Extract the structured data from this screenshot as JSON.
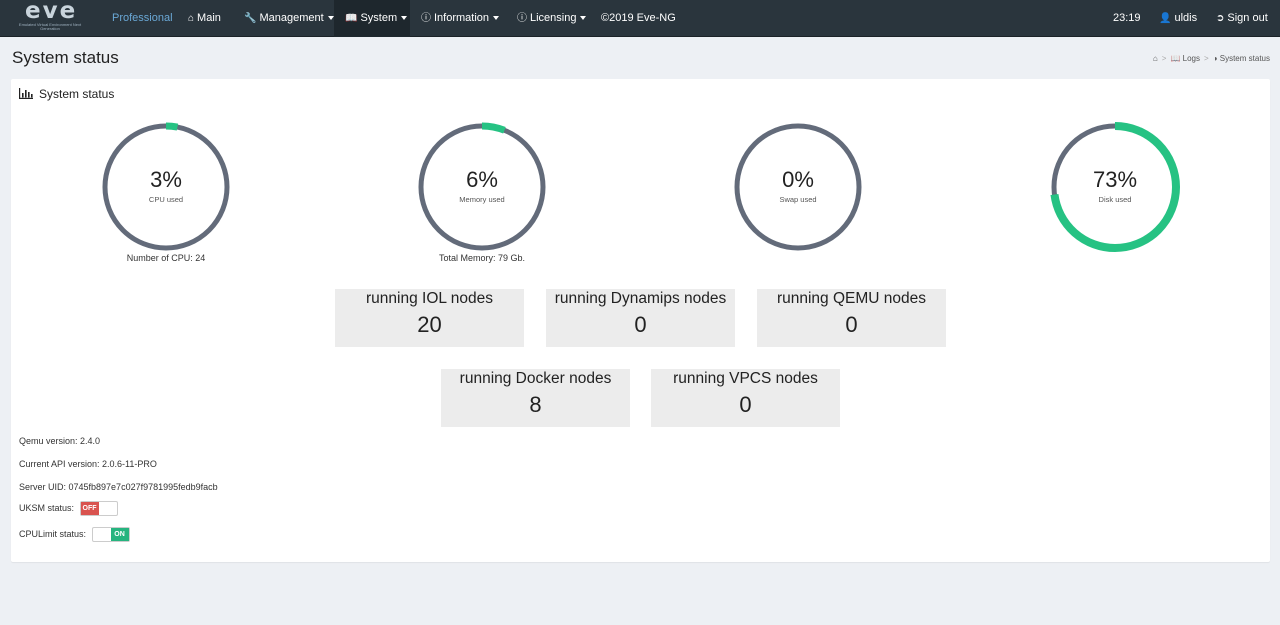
{
  "nav": {
    "logo_text": "eve",
    "logo_subtitle": "Emulated Virtual Environment Next Generation",
    "edition": "Professional",
    "items": [
      {
        "icon": "home-icon",
        "label": "Main",
        "caret": false
      },
      {
        "icon": "wrench-icon",
        "label": "Management",
        "caret": true
      },
      {
        "icon": "book-icon",
        "label": "System",
        "caret": true
      },
      {
        "icon": "info-icon",
        "label": "Information",
        "caret": true
      },
      {
        "icon": "info-icon",
        "label": "Licensing",
        "caret": true
      }
    ],
    "copyright": "©2019 Eve-NG",
    "time": "23:19",
    "user": "uldis",
    "signout": "Sign out"
  },
  "page": {
    "title": "System status",
    "breadcrumb": [
      "Logs",
      "System status"
    ]
  },
  "panel": {
    "title": "System status",
    "gauges": [
      {
        "value": "3%",
        "percent": 3,
        "label": "CPU used",
        "foot": "Number of CPU: 24"
      },
      {
        "value": "6%",
        "percent": 6,
        "label": "Memory used",
        "foot": "Total Memory: 79 Gb."
      },
      {
        "value": "0%",
        "percent": 0,
        "label": "Swap used",
        "foot": ""
      },
      {
        "value": "73%",
        "percent": 73,
        "label": "Disk used",
        "foot": ""
      }
    ],
    "nodes": [
      {
        "title": "running IOL nodes",
        "count": "20"
      },
      {
        "title": "running Dynamips nodes",
        "count": "0"
      },
      {
        "title": "running QEMU nodes",
        "count": "0"
      },
      {
        "title": "running Docker nodes",
        "count": "8"
      },
      {
        "title": "running VPCS nodes",
        "count": "0"
      }
    ],
    "info": {
      "qemu_version": "Qemu version: 2.4.0",
      "api_version": "Current API version: 2.0.6-11-PRO",
      "server_uid": "Server UID: 0745fb897e7c027f9781995fedb9facb",
      "uksm_label": "UKSM status:",
      "uksm_state": "OFF",
      "cpulimit_label": "CPULimit status:",
      "cpulimit_state": "ON"
    }
  },
  "colors": {
    "navbar": "#2a353d",
    "gauge_track": "#636b7a",
    "gauge_fill": "#26c283",
    "edition": "#6aa8d6"
  }
}
